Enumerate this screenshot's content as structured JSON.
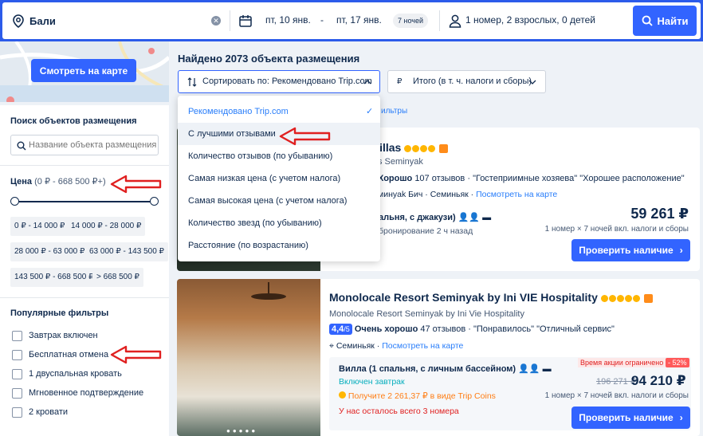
{
  "search": {
    "destination": "Бали",
    "checkin": "пт, 10 янв.",
    "dash": "-",
    "checkout": "пт, 17 янв.",
    "nights": "7 ночей",
    "guests": "1 номер, 2 взрослых, 0 детей",
    "find_label": "Найти"
  },
  "sidebar": {
    "map_button": "Смотреть на карте",
    "search_title": "Поиск объектов размещения",
    "search_placeholder": "Название объекта размещения",
    "price_label": "Цена",
    "price_range": "(0 ₽ - 668 500 ₽+)",
    "price_chips": [
      "0 ₽ - 14 000 ₽",
      "14 000 ₽ - 28 000 ₽",
      "28 000 ₽ - 63 000 ₽",
      "63 000 ₽ - 143 500 ₽",
      "143 500 ₽ - 668 500 ₽",
      "> 668 500 ₽"
    ],
    "popular_title": "Популярные фильтры",
    "filters": [
      "Завтрак включен",
      "Бесплатная отмена",
      "1 двуспальная кровать",
      "Мгновенное подтверждение",
      "2 кровати"
    ]
  },
  "main": {
    "found": "Найдено 2073 объекта размещения",
    "sort_label": "Сортировать по: Рекомендовано Trip.com",
    "price_mode": "Итого (в т. ч. налоги и сборы)",
    "filters_partial": "ильтры"
  },
  "sort_options": [
    "Рекомендовано Trip.com",
    "С лучшими отзывами",
    "Количество отзывов (по убыванию)",
    "Самая низкая цена (с учетом налога)",
    "Самая высокая цена (с учетом налога)",
    "Количество звезд (по убыванию)",
    "Расстояние (по возрастанию)"
  ],
  "hotel1": {
    "name_partial": "Villas",
    "sub_partial": "s Seminyak",
    "rating_text": "Хорошо",
    "reviews": "107 отзывов",
    "tags": [
      "\"Гостеприимные хозяева\"",
      "\"Хорошее расположение\""
    ],
    "location": "минyak Бич · Семиньяк ·",
    "map_link": "Посмотреть на карте",
    "room": "альня, с джакузи)",
    "note": "бронирование 2 ч назад",
    "price": "59 261 ₽",
    "price_note": "1 номер × 7 ночей вкл. налоги и сборы",
    "cta": "Проверить наличие"
  },
  "hotel2": {
    "name": "Monolocale Resort Seminyak by Ini VIE Hospitality",
    "sub": "Monolocale Resort Seminyak by Ini Vie Hospitality",
    "score": "4,4",
    "score_max": "/5",
    "rating_text": "Очень хорошо",
    "reviews": "47 отзывов",
    "tags": [
      "\"Понравилось\"",
      "\"Отличный сервис\""
    ],
    "location": "Семиньяк ·",
    "map_link": "Посмотреть на карте",
    "room": "Вилла (1 спальня, с личным бассейном)",
    "breakfast": "Включен завтрак",
    "coins": "Получите 2 261,37 ₽ в виде Trip Coins",
    "left": "У нас осталось всего 3 номера",
    "promo": "Время акции ограничено",
    "discount": "- 52%",
    "old_price": "196 271 ₽",
    "price": "94 210 ₽",
    "price_note": "1 номер × 7 ночей вкл. налоги и сборы",
    "cta": "Проверить наличие"
  },
  "colors": {
    "brand": "#3264ff",
    "annotation_arrow": "#e02020",
    "star": "#ffb600"
  }
}
